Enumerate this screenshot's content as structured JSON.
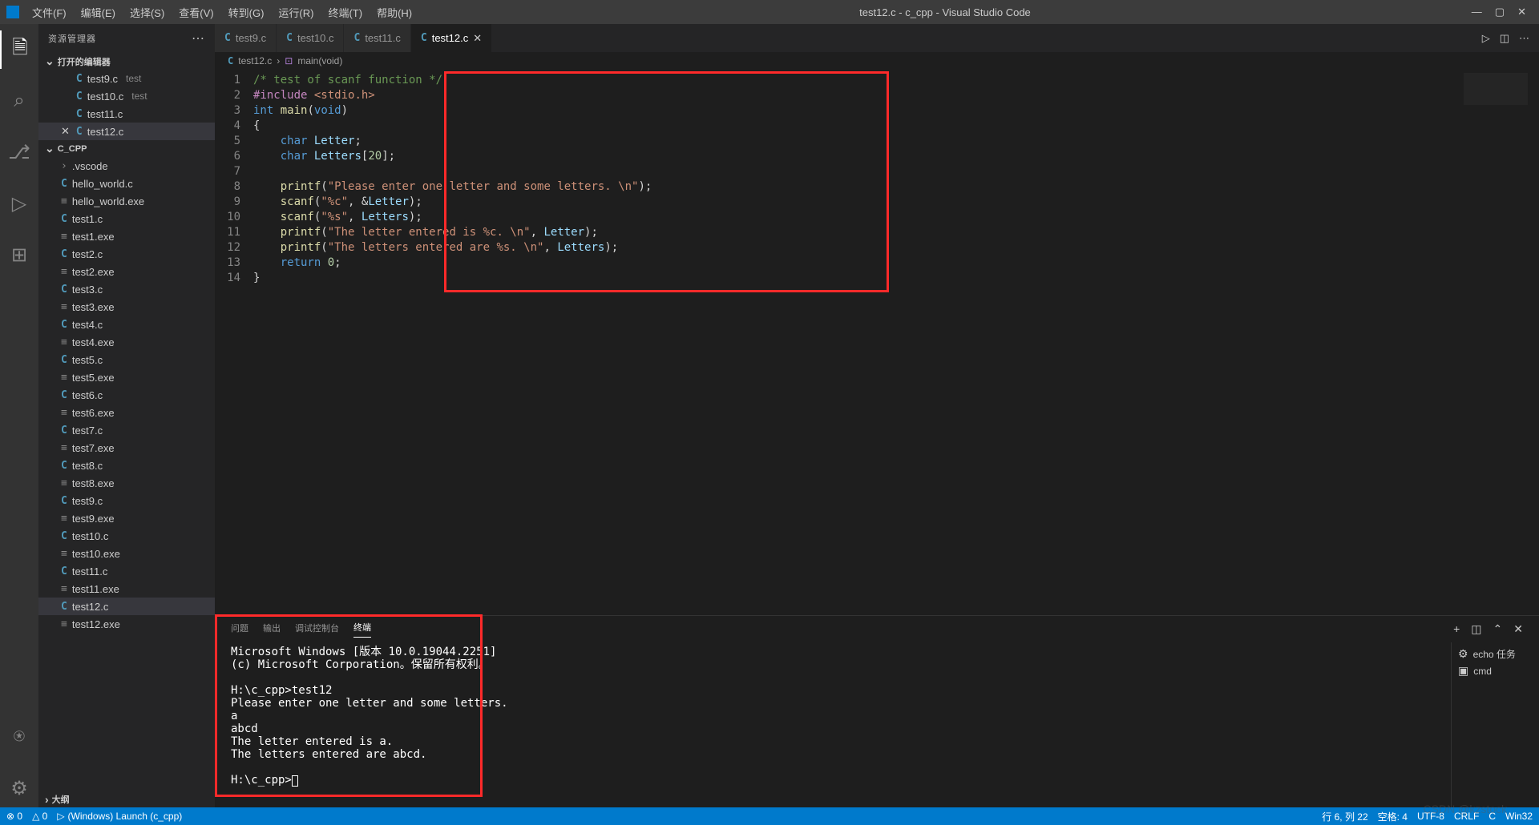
{
  "titlebar": {
    "title": "test12.c - c_cpp - Visual Studio Code",
    "menus": [
      "文件(F)",
      "编辑(E)",
      "选择(S)",
      "查看(V)",
      "转到(G)",
      "运行(R)",
      "终端(T)",
      "帮助(H)"
    ]
  },
  "sidebar": {
    "header": "资源管理器",
    "open_editors_label": "打开的编辑器",
    "open_editors": [
      {
        "name": "test9.c",
        "sub": "test",
        "kind": "c",
        "closeable": false
      },
      {
        "name": "test10.c",
        "sub": "test",
        "kind": "c",
        "closeable": false
      },
      {
        "name": "test11.c",
        "sub": "",
        "kind": "c",
        "closeable": false
      },
      {
        "name": "test12.c",
        "sub": "",
        "kind": "c",
        "closeable": true,
        "active": true
      }
    ],
    "project_label": "C_CPP",
    "files": [
      {
        "name": ".vscode",
        "kind": "folder"
      },
      {
        "name": "hello_world.c",
        "kind": "c"
      },
      {
        "name": "hello_world.exe",
        "kind": "exe"
      },
      {
        "name": "test1.c",
        "kind": "c"
      },
      {
        "name": "test1.exe",
        "kind": "exe"
      },
      {
        "name": "test2.c",
        "kind": "c"
      },
      {
        "name": "test2.exe",
        "kind": "exe"
      },
      {
        "name": "test3.c",
        "kind": "c"
      },
      {
        "name": "test3.exe",
        "kind": "exe"
      },
      {
        "name": "test4.c",
        "kind": "c"
      },
      {
        "name": "test4.exe",
        "kind": "exe"
      },
      {
        "name": "test5.c",
        "kind": "c"
      },
      {
        "name": "test5.exe",
        "kind": "exe"
      },
      {
        "name": "test6.c",
        "kind": "c"
      },
      {
        "name": "test6.exe",
        "kind": "exe"
      },
      {
        "name": "test7.c",
        "kind": "c"
      },
      {
        "name": "test7.exe",
        "kind": "exe"
      },
      {
        "name": "test8.c",
        "kind": "c"
      },
      {
        "name": "test8.exe",
        "kind": "exe"
      },
      {
        "name": "test9.c",
        "kind": "c"
      },
      {
        "name": "test9.exe",
        "kind": "exe"
      },
      {
        "name": "test10.c",
        "kind": "c"
      },
      {
        "name": "test10.exe",
        "kind": "exe"
      },
      {
        "name": "test11.c",
        "kind": "c"
      },
      {
        "name": "test11.exe",
        "kind": "exe"
      },
      {
        "name": "test12.c",
        "kind": "c",
        "active": true
      },
      {
        "name": "test12.exe",
        "kind": "exe"
      }
    ],
    "outline_label": "大纲"
  },
  "tabs": [
    {
      "name": "test9.c"
    },
    {
      "name": "test10.c"
    },
    {
      "name": "test11.c"
    },
    {
      "name": "test12.c",
      "active": true,
      "closeable": true
    }
  ],
  "breadcrumb": {
    "file": "test12.c",
    "symbol": "main(void)"
  },
  "code": {
    "line_count": 14,
    "lines": [
      [
        [
          "comment",
          "/* test of scanf function */"
        ]
      ],
      [
        [
          "macro",
          "#include"
        ],
        [
          "punc",
          " "
        ],
        [
          "include",
          "<stdio.h>"
        ]
      ],
      [
        [
          "type",
          "int"
        ],
        [
          "punc",
          " "
        ],
        [
          "fn",
          "main"
        ],
        [
          "punc",
          "("
        ],
        [
          "type",
          "void"
        ],
        [
          "punc",
          ")"
        ]
      ],
      [
        [
          "punc",
          "{"
        ]
      ],
      [
        [
          "punc",
          "    "
        ],
        [
          "type",
          "char"
        ],
        [
          "punc",
          " "
        ],
        [
          "var",
          "Letter"
        ],
        [
          "punc",
          ";"
        ]
      ],
      [
        [
          "punc",
          "    "
        ],
        [
          "type",
          "char"
        ],
        [
          "punc",
          " "
        ],
        [
          "var",
          "Letters"
        ],
        [
          "punc",
          "["
        ],
        [
          "num",
          "20"
        ],
        [
          "punc",
          "];"
        ]
      ],
      [],
      [
        [
          "punc",
          "    "
        ],
        [
          "fn",
          "printf"
        ],
        [
          "punc",
          "("
        ],
        [
          "str",
          "\"Please enter one letter and some letters. \\n\""
        ],
        [
          "punc",
          ");"
        ]
      ],
      [
        [
          "punc",
          "    "
        ],
        [
          "fn",
          "scanf"
        ],
        [
          "punc",
          "("
        ],
        [
          "str",
          "\"%c\""
        ],
        [
          "punc",
          ", "
        ],
        [
          "op",
          "&"
        ],
        [
          "var",
          "Letter"
        ],
        [
          "punc",
          ");"
        ]
      ],
      [
        [
          "punc",
          "    "
        ],
        [
          "fn",
          "scanf"
        ],
        [
          "punc",
          "("
        ],
        [
          "str",
          "\"%s\""
        ],
        [
          "punc",
          ", "
        ],
        [
          "var",
          "Letters"
        ],
        [
          "punc",
          ");"
        ]
      ],
      [
        [
          "punc",
          "    "
        ],
        [
          "fn",
          "printf"
        ],
        [
          "punc",
          "("
        ],
        [
          "str",
          "\"The letter entered is %c. \\n\""
        ],
        [
          "punc",
          ", "
        ],
        [
          "var",
          "Letter"
        ],
        [
          "punc",
          ");"
        ]
      ],
      [
        [
          "punc",
          "    "
        ],
        [
          "fn",
          "printf"
        ],
        [
          "punc",
          "("
        ],
        [
          "str",
          "\"The letters entered are %s. \\n\""
        ],
        [
          "punc",
          ", "
        ],
        [
          "var",
          "Letters"
        ],
        [
          "punc",
          ");"
        ]
      ],
      [
        [
          "punc",
          "    "
        ],
        [
          "kw",
          "return"
        ],
        [
          "punc",
          " "
        ],
        [
          "num",
          "0"
        ],
        [
          "punc",
          ";"
        ]
      ],
      [
        [
          "punc",
          "}"
        ]
      ]
    ],
    "highlight_line": 6
  },
  "panel": {
    "tabs": [
      "问题",
      "输出",
      "调试控制台",
      "终端"
    ],
    "active_tab": 3,
    "terminal_text": "Microsoft Windows [版本 10.0.19044.2251]\n(c) Microsoft Corporation。保留所有权利。\n\nH:\\c_cpp>test12\nPlease enter one letter and some letters.\na\nabcd\nThe letter entered is a.\nThe letters entered are abcd.\n\nH:\\c_cpp>",
    "side": [
      {
        "icon": "⚙",
        "label": "echo 任务"
      },
      {
        "icon": "▣",
        "label": "cmd"
      }
    ]
  },
  "statusbar": {
    "errors": "⊗ 0",
    "warnings": "△ 0",
    "launch": "(Windows) Launch (c_cpp)",
    "pos": "行 6, 列 22",
    "spaces": "空格: 4",
    "encoding": "UTF-8",
    "eol": "CRLF",
    "lang": "C",
    "os": "Win32",
    "watermark": "CSDN @kzstock"
  }
}
